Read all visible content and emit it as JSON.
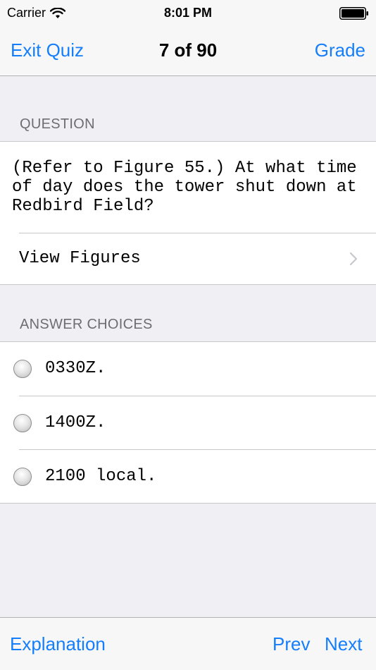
{
  "status_bar": {
    "carrier": "Carrier",
    "time": "8:01 PM",
    "icons": [
      "wifi-icon",
      "battery-icon"
    ]
  },
  "nav": {
    "left_button": "Exit Quiz",
    "title": "7 of 90",
    "right_button": "Grade"
  },
  "question_section": {
    "header": "QUESTION",
    "text": "(Refer to Figure 55.) At what time of day does the tower shut down at Redbird Field?",
    "view_figures_label": "View Figures"
  },
  "answers_section": {
    "header": "ANSWER CHOICES",
    "choices": [
      "0330Z.",
      "1400Z.",
      "2100 local."
    ]
  },
  "toolbar": {
    "explanation": "Explanation",
    "prev": "Prev",
    "next": "Next"
  },
  "colors": {
    "accent": "#157efb",
    "background": "#efeff4",
    "bar": "#f7f7f7",
    "header_text": "#6d6d72"
  }
}
